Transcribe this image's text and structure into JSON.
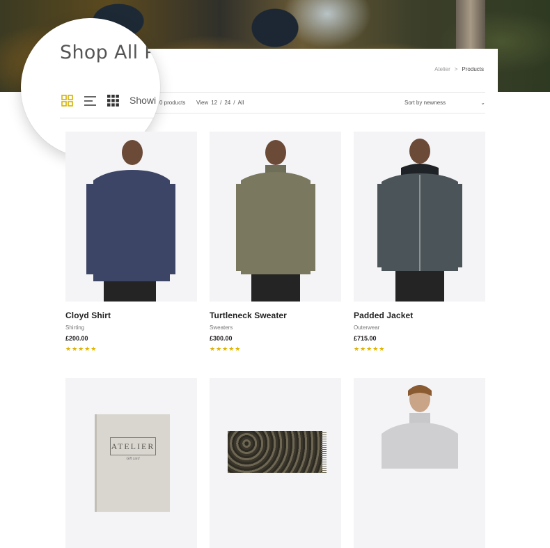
{
  "page": {
    "title": "Shop All Products",
    "magnified_title": "Shop All Pro",
    "breadcrumb": {
      "home": "Atelier",
      "separator": ">",
      "current": "Products"
    }
  },
  "toolbar": {
    "showing_partial": "Showi",
    "count_text": "0 products",
    "view_label": "View",
    "view_options": [
      "12",
      "/",
      "24",
      "/",
      "All"
    ],
    "sort_label": "Sort by newness",
    "sort_caret": "⌄"
  },
  "colors": {
    "accent": "#e0b400",
    "active_icon": "#d4b300"
  },
  "icons": [
    "grid-2x2-icon",
    "list-icon",
    "grid-3x3-icon"
  ],
  "products": [
    {
      "name": "Cloyd Shirt",
      "category": "Shirting",
      "price": "£200.00",
      "rating": "★★★★★",
      "rating_value": 5
    },
    {
      "name": "Turtleneck Sweater",
      "category": "Sweaters",
      "price": "£300.00",
      "rating": "★★★★★",
      "rating_value": 5
    },
    {
      "name": "Padded Jacket",
      "category": "Outerwear",
      "price": "£715.00",
      "rating": "★★★★★",
      "rating_value": 5
    },
    {
      "name": "",
      "category": "",
      "price": "",
      "rating": "",
      "book_title": "ATELIER",
      "book_sub": "Gift card"
    },
    {
      "name": "",
      "category": "",
      "price": "",
      "rating": ""
    },
    {
      "name": "",
      "category": "",
      "price": "",
      "rating": ""
    }
  ]
}
